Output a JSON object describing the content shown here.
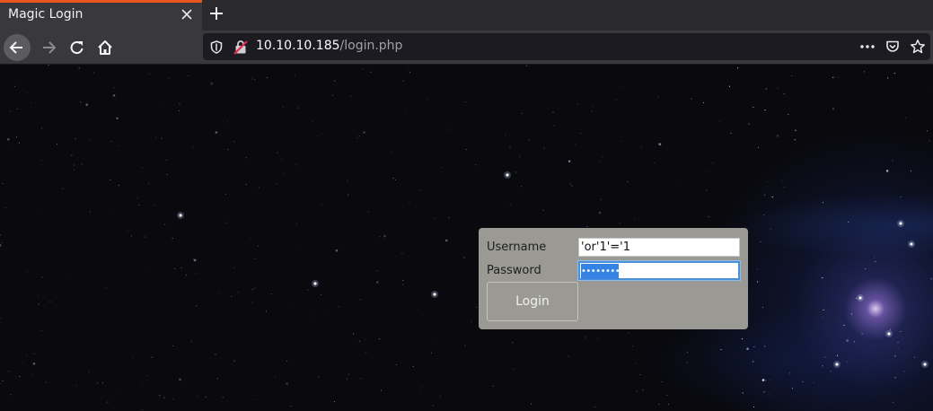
{
  "browser": {
    "tab_title": "Magic Login",
    "url_host": "10.10.10.185",
    "url_path": "/login.php",
    "accent": "#e95420",
    "icons": [
      "close-icon",
      "plus-icon",
      "back-arrow-icon",
      "forward-arrow-icon",
      "reload-icon",
      "home-icon",
      "shield-icon",
      "insecure-lock-icon",
      "more-icon",
      "pocket-icon",
      "star-icon"
    ]
  },
  "login": {
    "username_label": "Username",
    "username_value": "'or'1'='1",
    "password_label": "Password",
    "password_mask": "••••••••••",
    "button_label": "Login",
    "panel_color": "#9a9993",
    "focus_color": "#3584e4"
  }
}
